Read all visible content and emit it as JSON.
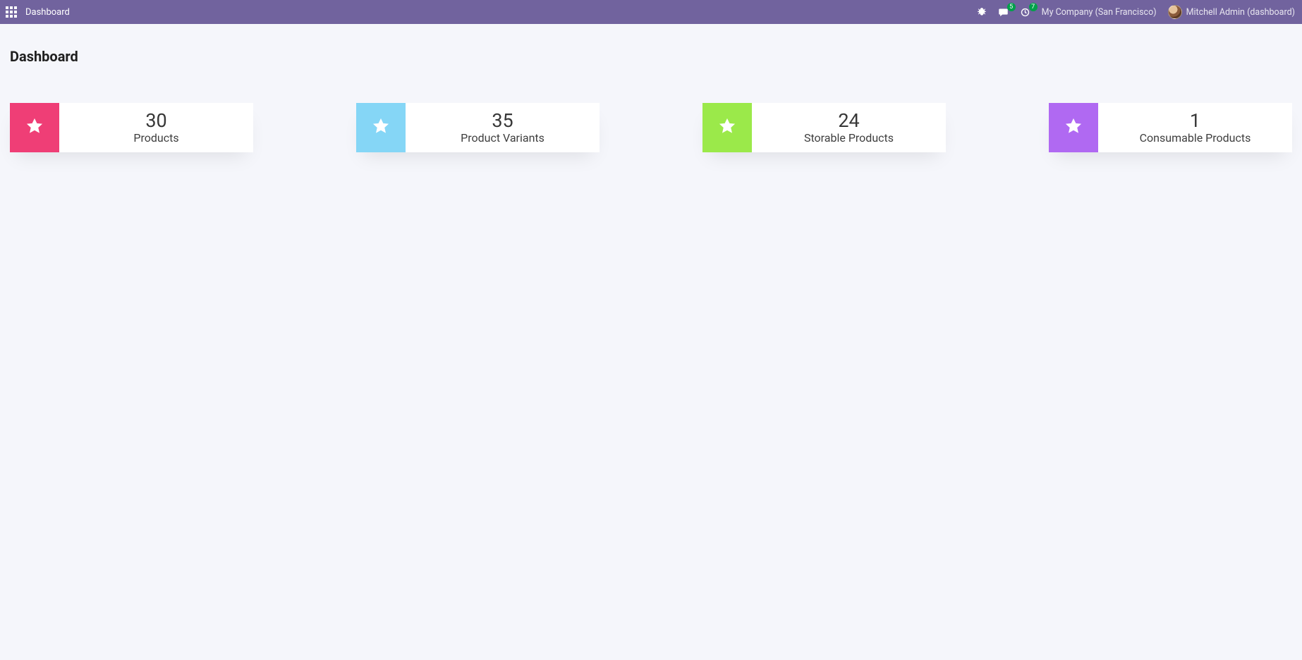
{
  "navbar": {
    "app_title": "Dashboard",
    "messages_badge": "5",
    "activities_badge": "7",
    "company": "My Company (San Francisco)",
    "user": "Mitchell Admin (dashboard)"
  },
  "page": {
    "title": "Dashboard"
  },
  "cards": [
    {
      "value": "30",
      "label": "Products",
      "accent": "pink",
      "icon": "star-icon"
    },
    {
      "value": "35",
      "label": "Product Variants",
      "accent": "blue",
      "icon": "star-icon"
    },
    {
      "value": "24",
      "label": "Storable Products",
      "accent": "green",
      "icon": "star-icon"
    },
    {
      "value": "1",
      "label": "Consumable Products",
      "accent": "purple",
      "icon": "star-icon"
    }
  ]
}
